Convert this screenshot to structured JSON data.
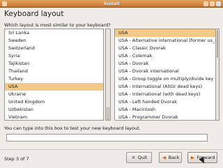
{
  "window": {
    "title": "Install"
  },
  "page": {
    "heading": "Keyboard layout",
    "prompt": "Which layout is most similar to your keyboard?",
    "test_label": "You can type into this box to test your new keyboard layout.",
    "test_input_value": "",
    "step": "Step 3 of 7"
  },
  "layouts": [
    {
      "label": "Sri Lanka"
    },
    {
      "label": "Sweden"
    },
    {
      "label": "Switzerland"
    },
    {
      "label": "Syria"
    },
    {
      "label": "Tajikistan"
    },
    {
      "label": "Thailand"
    },
    {
      "label": "Turkey"
    },
    {
      "label": "USA",
      "selected": true
    },
    {
      "label": "Ukraine"
    },
    {
      "label": "United Kingdom"
    },
    {
      "label": "Uzbekistan"
    },
    {
      "label": "Vietnam"
    }
  ],
  "variants": [
    {
      "label": "USA",
      "selected": true
    },
    {
      "label": "USA - Alternative international (former us_intl)"
    },
    {
      "label": "USA - Classic Dvorak"
    },
    {
      "label": "USA - Colemak"
    },
    {
      "label": "USA - Dvorak"
    },
    {
      "label": "USA - Dvorak international"
    },
    {
      "label": "USA - Group toggle on multiply/divide key"
    },
    {
      "label": "USA - International (AltGr dead keys)"
    },
    {
      "label": "USA - International (with dead keys)"
    },
    {
      "label": "USA - Left handed Dvorak"
    },
    {
      "label": "USA - Macintosh"
    },
    {
      "label": "USA - Programmer Dvorak"
    }
  ],
  "buttons": {
    "quit": "Quit",
    "back": "Back",
    "forward": "Forward"
  },
  "colors": {
    "titlebar": "#d98b45",
    "selection": "#f3c98a",
    "accent": "#d7650f"
  }
}
